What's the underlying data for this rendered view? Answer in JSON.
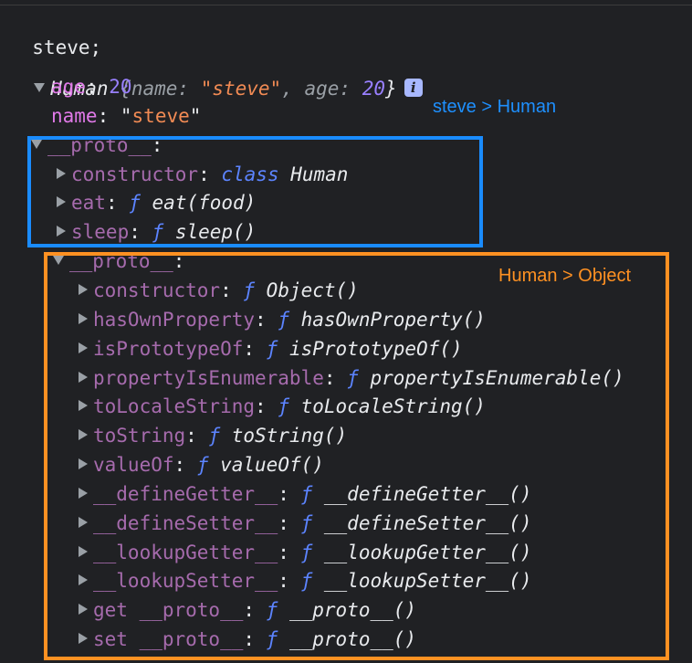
{
  "console": {
    "input": "steve;",
    "summary": {
      "class_name": "Human",
      "open": " {",
      "k1": "name",
      "v1": "\"steve\"",
      "sep": ", ",
      "k2": "age",
      "v2": "20",
      "close": "}",
      "info_icon": "i"
    },
    "rows": [
      {
        "level": 1,
        "toggle": "none",
        "key": "age",
        "kind": "own",
        "value": [
          {
            "t": "20",
            "c": "num"
          }
        ]
      },
      {
        "level": 1,
        "toggle": "none",
        "key": "name",
        "kind": "own",
        "value": [
          {
            "t": "\"",
            "c": ""
          },
          {
            "t": "steve",
            "c": "str"
          },
          {
            "t": "\"",
            "c": ""
          }
        ]
      },
      {
        "level": 1,
        "toggle": "down",
        "key": "__proto__",
        "kind": "proto",
        "value": []
      },
      {
        "level": 2,
        "toggle": "right",
        "key": "constructor",
        "kind": "proto",
        "value": [
          {
            "t": "class",
            "c": "fn"
          },
          {
            "t": " Human",
            "c": "it"
          }
        ]
      },
      {
        "level": 2,
        "toggle": "right",
        "key": "eat",
        "kind": "proto",
        "value": [
          {
            "t": "ƒ",
            "c": "fn"
          },
          {
            "t": " eat(food)",
            "c": "it"
          }
        ]
      },
      {
        "level": 2,
        "toggle": "right",
        "key": "sleep",
        "kind": "proto",
        "value": [
          {
            "t": "ƒ",
            "c": "fn"
          },
          {
            "t": " sleep()",
            "c": "it"
          }
        ]
      },
      {
        "level": 2,
        "toggle": "down",
        "key": "__proto__",
        "kind": "proto",
        "value": []
      },
      {
        "level": 3,
        "toggle": "right",
        "key": "constructor",
        "kind": "proto",
        "value": [
          {
            "t": "ƒ",
            "c": "fn"
          },
          {
            "t": " Object()",
            "c": "it"
          }
        ]
      },
      {
        "level": 3,
        "toggle": "right",
        "key": "hasOwnProperty",
        "kind": "proto",
        "value": [
          {
            "t": "ƒ",
            "c": "fn"
          },
          {
            "t": " hasOwnProperty()",
            "c": "it"
          }
        ]
      },
      {
        "level": 3,
        "toggle": "right",
        "key": "isPrototypeOf",
        "kind": "proto",
        "value": [
          {
            "t": "ƒ",
            "c": "fn"
          },
          {
            "t": " isPrototypeOf()",
            "c": "it"
          }
        ]
      },
      {
        "level": 3,
        "toggle": "right",
        "key": "propertyIsEnumerable",
        "kind": "proto",
        "value": [
          {
            "t": "ƒ",
            "c": "fn"
          },
          {
            "t": " propertyIsEnumerable()",
            "c": "it"
          }
        ]
      },
      {
        "level": 3,
        "toggle": "right",
        "key": "toLocaleString",
        "kind": "proto",
        "value": [
          {
            "t": "ƒ",
            "c": "fn"
          },
          {
            "t": " toLocaleString()",
            "c": "it"
          }
        ]
      },
      {
        "level": 3,
        "toggle": "right",
        "key": "toString",
        "kind": "proto",
        "value": [
          {
            "t": "ƒ",
            "c": "fn"
          },
          {
            "t": " toString()",
            "c": "it"
          }
        ]
      },
      {
        "level": 3,
        "toggle": "right",
        "key": "valueOf",
        "kind": "proto",
        "value": [
          {
            "t": "ƒ",
            "c": "fn"
          },
          {
            "t": " valueOf()",
            "c": "it"
          }
        ]
      },
      {
        "level": 3,
        "toggle": "right",
        "key": "__defineGetter__",
        "kind": "proto",
        "value": [
          {
            "t": "ƒ",
            "c": "fn"
          },
          {
            "t": " __defineGetter__()",
            "c": "it"
          }
        ]
      },
      {
        "level": 3,
        "toggle": "right",
        "key": "__defineSetter__",
        "kind": "proto",
        "value": [
          {
            "t": "ƒ",
            "c": "fn"
          },
          {
            "t": " __defineSetter__()",
            "c": "it"
          }
        ]
      },
      {
        "level": 3,
        "toggle": "right",
        "key": "__lookupGetter__",
        "kind": "proto",
        "value": [
          {
            "t": "ƒ",
            "c": "fn"
          },
          {
            "t": " __lookupGetter__()",
            "c": "it"
          }
        ]
      },
      {
        "level": 3,
        "toggle": "right",
        "key": "__lookupSetter__",
        "kind": "proto",
        "value": [
          {
            "t": "ƒ",
            "c": "fn"
          },
          {
            "t": " __lookupSetter__()",
            "c": "it"
          }
        ]
      },
      {
        "level": 3,
        "toggle": "right",
        "key": "get __proto__",
        "kind": "proto",
        "value": [
          {
            "t": "ƒ",
            "c": "fn"
          },
          {
            "t": " __proto__()",
            "c": "it"
          }
        ]
      },
      {
        "level": 3,
        "toggle": "right",
        "key": "set __proto__",
        "kind": "proto",
        "value": [
          {
            "t": "ƒ",
            "c": "fn"
          },
          {
            "t": " __proto__()",
            "c": "it"
          }
        ]
      }
    ]
  },
  "annotations": {
    "blue_label": "steve > Human",
    "orange_label": "Human > Object",
    "blue_color": "#1a8cff",
    "orange_color": "#ff9122"
  }
}
